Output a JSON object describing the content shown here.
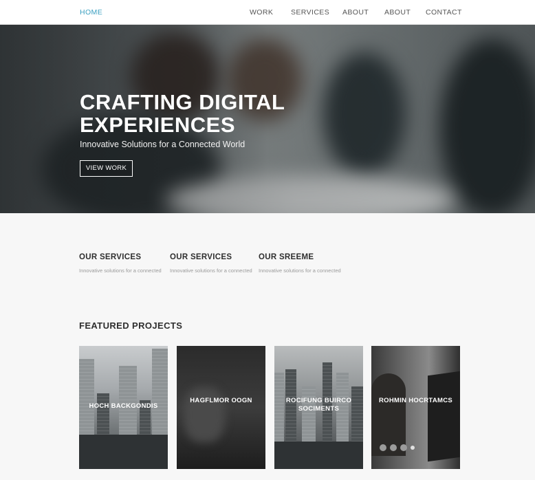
{
  "nav": {
    "items": [
      {
        "label": "HOME",
        "active": true
      },
      {
        "label": "WORK"
      },
      {
        "label": "SERVICES"
      },
      {
        "label": "ABOUT"
      },
      {
        "label": "ABOUT"
      },
      {
        "label": "CONTACT"
      }
    ]
  },
  "hero": {
    "title": "CRAFTING DIGITAL EXPERIENCES",
    "subtitle": "Innovative Solutions for a Connected World",
    "button": "VIEW WORK"
  },
  "services": [
    {
      "title": "OUR SERVICES",
      "text": "Innovative solutions for a connected"
    },
    {
      "title": "OUR SERVICES",
      "text": "Innovative solutions for a connected"
    },
    {
      "title": "OUR SREEME",
      "text": "Innovative solutions for a connected"
    }
  ],
  "featured": {
    "heading": "FEATURED PROJECTS",
    "cards": [
      {
        "caption": "HOCH BACKGONDIS",
        "icon": "city-photo"
      },
      {
        "caption": "HAGFLMOR OOGN",
        "icon": "people-photo"
      },
      {
        "caption": "ROCIFUNG BUIRCO SOCIMENTS",
        "icon": "city-photo"
      },
      {
        "caption": "ROHMIN HOCRTAMCS",
        "icon": "person-photo"
      }
    ]
  },
  "colors": {
    "accent": "#3a9fc0",
    "text": "#2e2e2e",
    "muted": "#9a9a9a"
  }
}
